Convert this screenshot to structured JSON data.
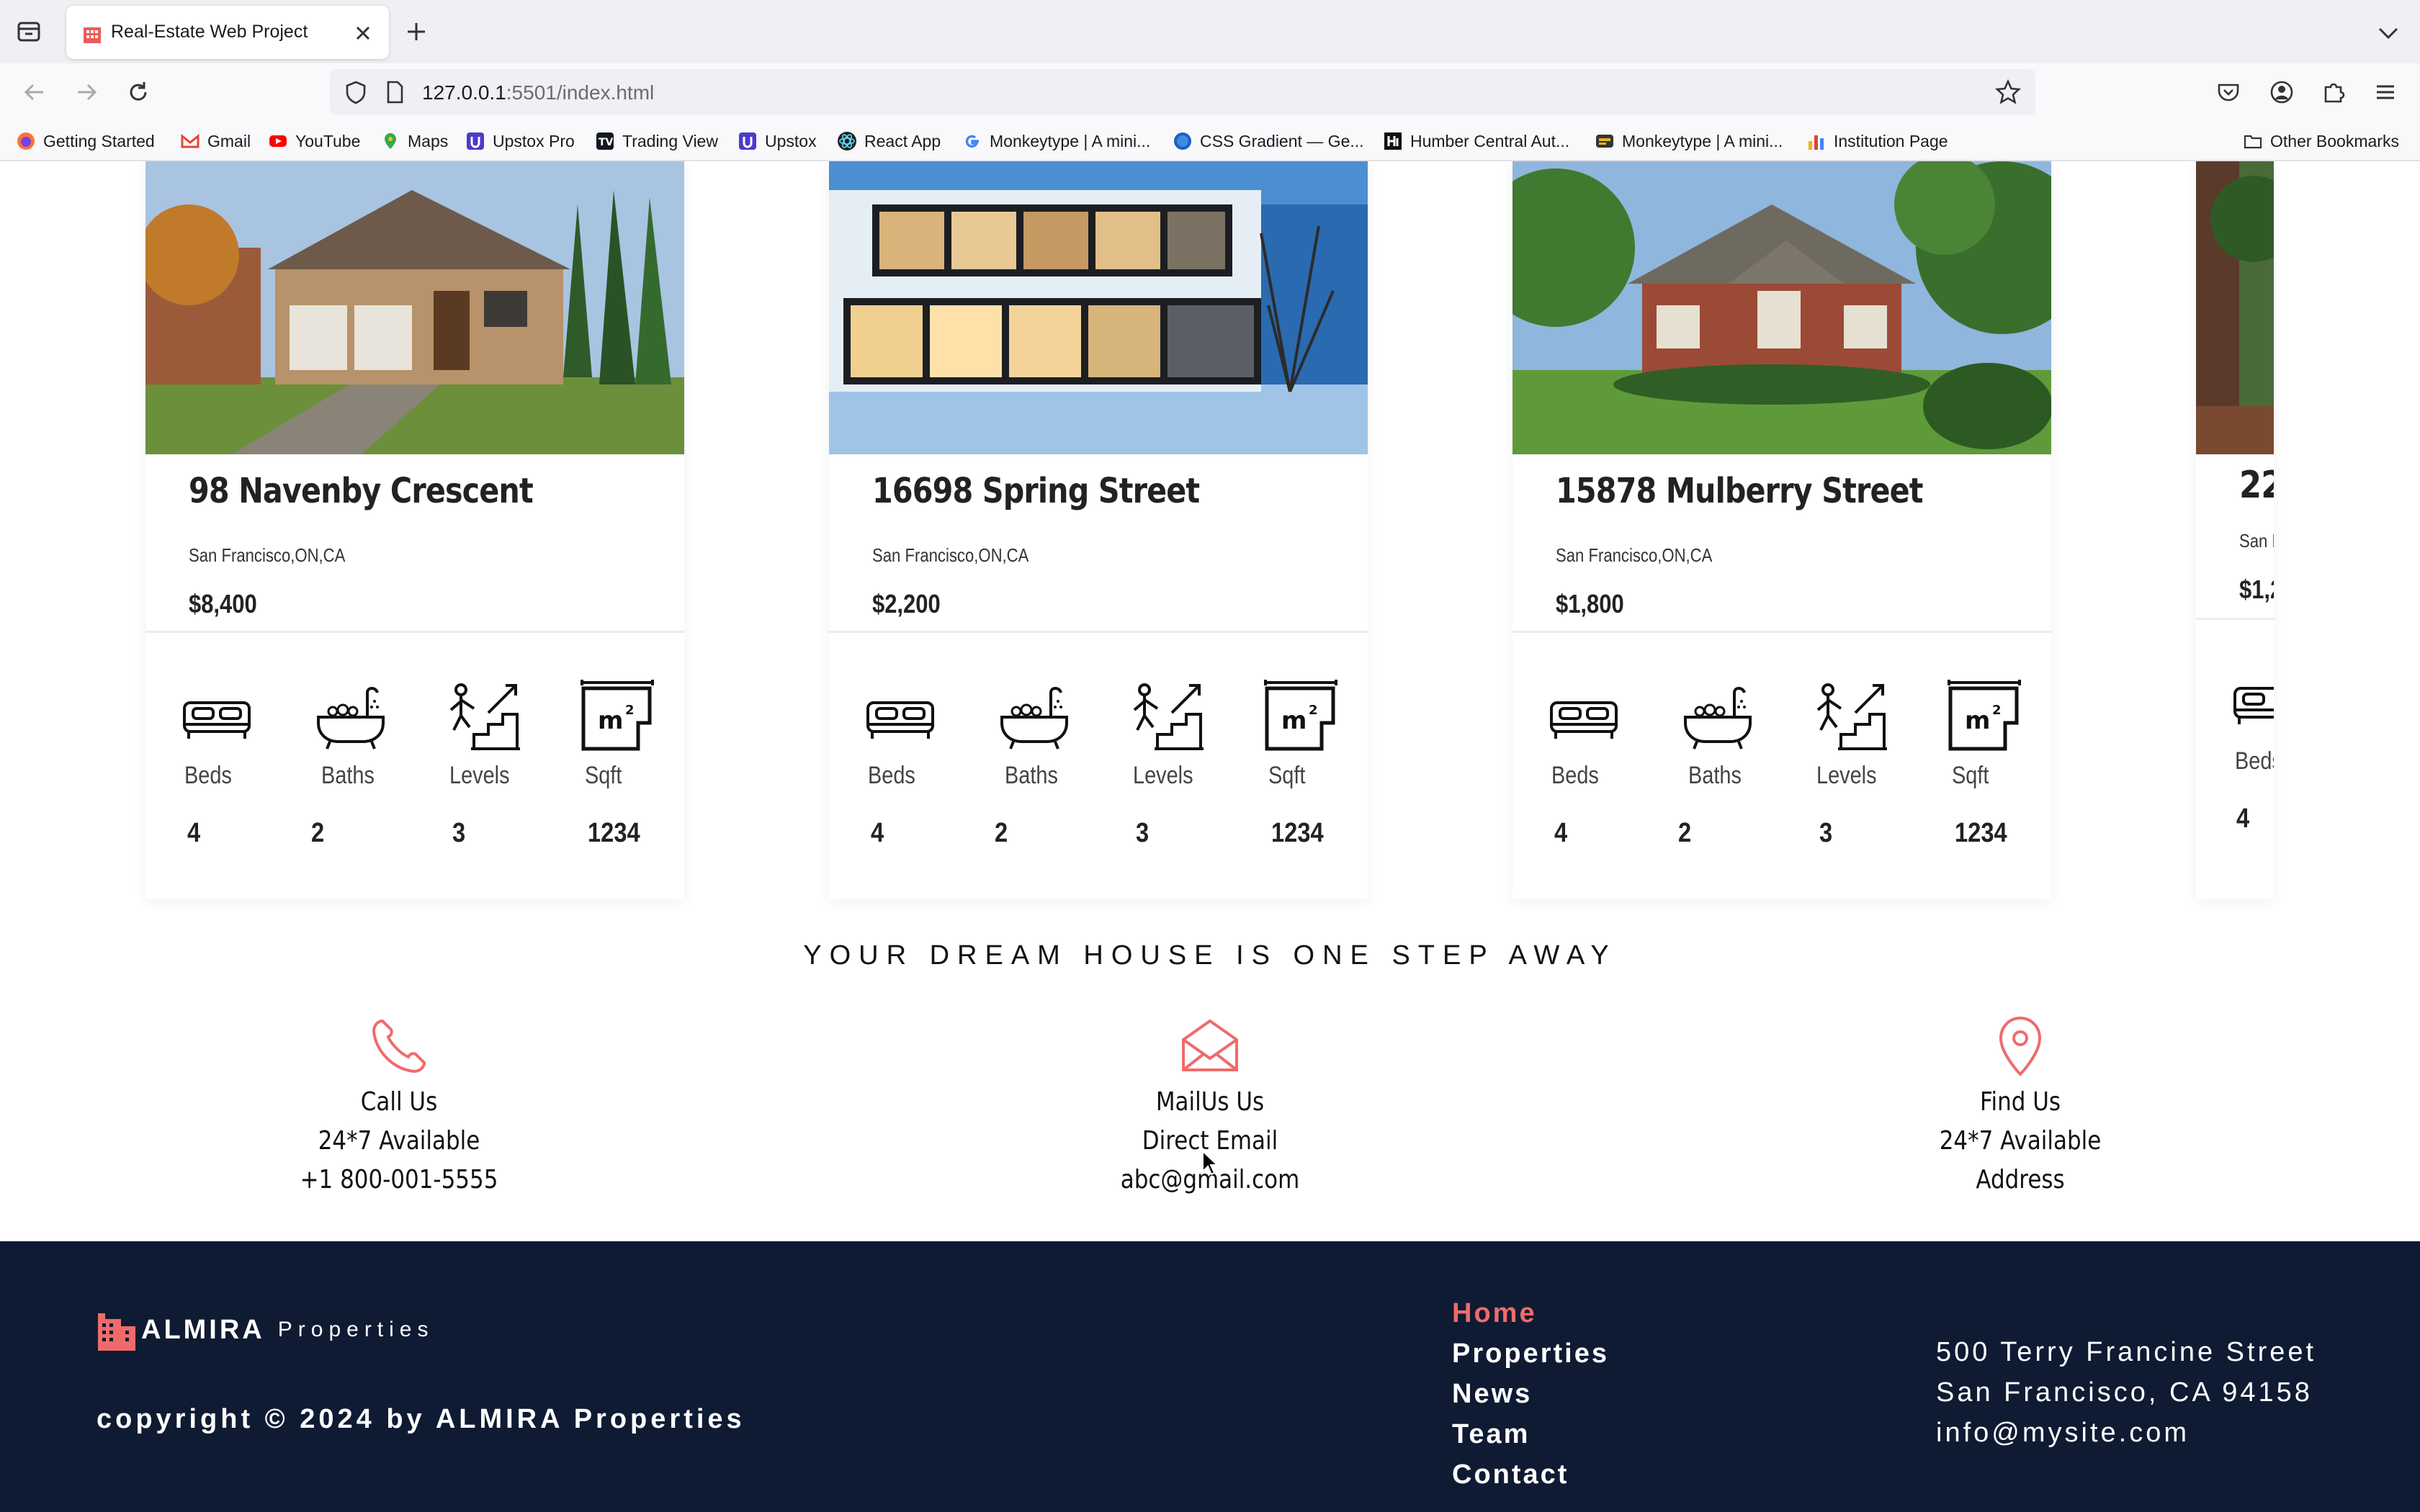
{
  "browser": {
    "tab_title": "Real-Estate Web Project",
    "url_host": "127.0.0.1",
    "url_rest": ":5501/index.html",
    "bookmarks": [
      {
        "label": "Getting Started",
        "icon": "firefox-icon"
      },
      {
        "label": "Gmail",
        "icon": "gmail-icon"
      },
      {
        "label": "YouTube",
        "icon": "youtube-icon"
      },
      {
        "label": "Maps",
        "icon": "maps-icon"
      },
      {
        "label": "Upstox Pro",
        "icon": "upstox-icon"
      },
      {
        "label": "Trading View",
        "icon": "tradingview-icon"
      },
      {
        "label": "Upstox",
        "icon": "upstox-icon"
      },
      {
        "label": "React App",
        "icon": "react-icon"
      },
      {
        "label": "Monkeytype | A mini...",
        "icon": "google-icon"
      },
      {
        "label": "CSS Gradient — Ge...",
        "icon": "globe-icon"
      },
      {
        "label": "Humber Central Aut...",
        "icon": "humber-icon"
      },
      {
        "label": "Monkeytype | A mini...",
        "icon": "monkeytype-icon"
      },
      {
        "label": "Institution Page",
        "icon": "chart-icon"
      }
    ],
    "other_bookmarks": "Other Bookmarks"
  },
  "listings": [
    {
      "address": "98 Navenby Crescent",
      "city": "San Francisco,ON,CA",
      "price": "$8,400",
      "beds": "4",
      "baths": "2",
      "levels": "3",
      "sqft": "1234"
    },
    {
      "address": "16698 Spring Street",
      "city": "San Francisco,ON,CA",
      "price": "$2,200",
      "beds": "4",
      "baths": "2",
      "levels": "3",
      "sqft": "1234"
    },
    {
      "address": "15878 Mulberry Street",
      "city": "San Francisco,ON,CA",
      "price": "$1,800",
      "beds": "4",
      "baths": "2",
      "levels": "3",
      "sqft": "1234"
    },
    {
      "address": "22",
      "city": "San F",
      "price": "$1,2",
      "beds": "4"
    }
  ],
  "feature_labels": {
    "beds": "Beds",
    "baths": "Baths",
    "levels": "Levels",
    "sqft": "Sqft"
  },
  "tagline": "YOUR DREAM HOUSE IS ONE STEP AWAY",
  "contacts": [
    {
      "title": "Call Us",
      "line1": "24*7 Available",
      "line2": "+1 800-001-5555",
      "icon": "phone-icon"
    },
    {
      "title": "MailUs Us",
      "line1": "Direct Email",
      "line2": "abc@gmail.com",
      "icon": "mail-icon"
    },
    {
      "title": "Find Us",
      "line1": "24*7 Available",
      "line2": "Address",
      "icon": "location-pin-icon"
    }
  ],
  "footer": {
    "brand": "ALMIRA",
    "brand_sub": "Properties",
    "copyright": "copyright © 2024 by ALMIRA Properties",
    "menu": [
      "Home",
      "Properties",
      "News",
      "Team",
      "Contact"
    ],
    "address": [
      "500 Terry Francine Street",
      "San Francisco, CA 94158",
      "info@mysite.com"
    ]
  },
  "colors": {
    "accent": "#ef6b6b",
    "footer_bg": "#0f1b33",
    "tab_bar": "#f0f0f4"
  }
}
